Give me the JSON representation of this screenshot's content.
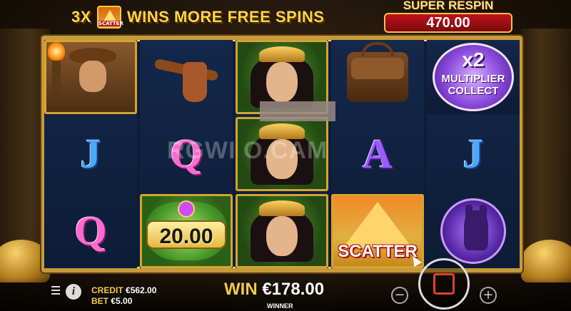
{
  "banner": {
    "prefix": "3X",
    "scatter_icon_label": "SCATTER",
    "text": "WINS MORE FREE SPINS"
  },
  "super_respin": {
    "title": "SUPER RESPIN",
    "value": "470.00"
  },
  "reels": [
    [
      "explorer-symbol",
      "letter-j",
      "letter-q"
    ],
    [
      "holster-symbol",
      "letter-q",
      "scarab-coin"
    ],
    [
      "cleopatra-symbol",
      "cleopatra-symbol",
      "cleopatra-symbol"
    ],
    [
      "satchel-symbol",
      "letter-a",
      "scatter-symbol"
    ],
    [
      "multiplier-collect",
      "letter-j",
      "anubis-symbol"
    ]
  ],
  "symbols": {
    "letter_j": "J",
    "letter_q": "Q",
    "letter_a": "A",
    "coin_value": "20.00",
    "scatter_label": "SCATTER",
    "multiplier_value": "x2",
    "multiplier_label_1": "MULTIPLIER",
    "multiplier_label_2": "COLLECT"
  },
  "watermark": "RGWI    O.CAM",
  "footer": {
    "credit_label": "CREDIT",
    "credit_value": "€562.00",
    "bet_label": "BET",
    "bet_value": "€5.00",
    "win_label": "WIN",
    "win_value": "€178.00",
    "winner_label": "WINNER",
    "minus": "−",
    "plus": "+",
    "info": "i"
  },
  "colors": {
    "gold": "#f2c74a",
    "respin_red": "#c0121a",
    "reel_bg": "#0e1c38"
  }
}
